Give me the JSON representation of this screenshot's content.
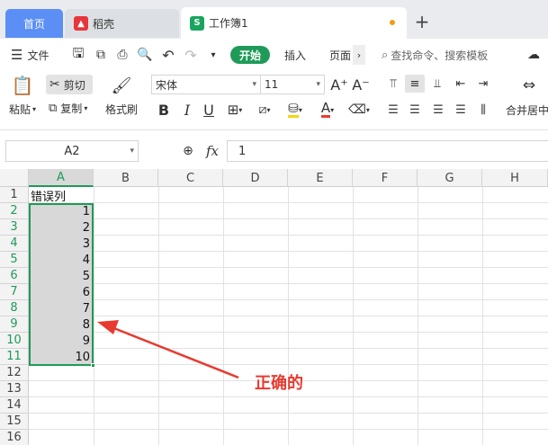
{
  "tabs": {
    "home": "首页",
    "dk": "稻壳",
    "book": "工作簿1",
    "plus": "+"
  },
  "toolbar": {
    "menu_file": "文件",
    "start": "开始",
    "insert": "插入",
    "page": "页面",
    "search": "查找命令、搜索模板"
  },
  "ribbon": {
    "paste": "粘贴",
    "cut": "剪切",
    "copy": "复制",
    "format_painter": "格式刷",
    "font_name": "宋体",
    "font_size": "11",
    "merge": "合并居中"
  },
  "formula_bar": {
    "name_box": "A2",
    "fx": "fx",
    "value": "1"
  },
  "sheet": {
    "columns": [
      "A",
      "B",
      "C",
      "D",
      "E",
      "F",
      "G",
      "H"
    ],
    "rows": [
      "1",
      "2",
      "3",
      "4",
      "5",
      "6",
      "7",
      "8",
      "9",
      "10",
      "11",
      "12",
      "13",
      "14",
      "15",
      "16"
    ],
    "a1": "错误列",
    "a_values": [
      "1",
      "2",
      "3",
      "4",
      "5",
      "6",
      "7",
      "8",
      "9",
      "10"
    ]
  },
  "annotation": "正确的",
  "colors": {
    "accent_green": "#1f9a58",
    "tab_blue": "#5c8ff5",
    "annotation_red": "#e83a30"
  }
}
